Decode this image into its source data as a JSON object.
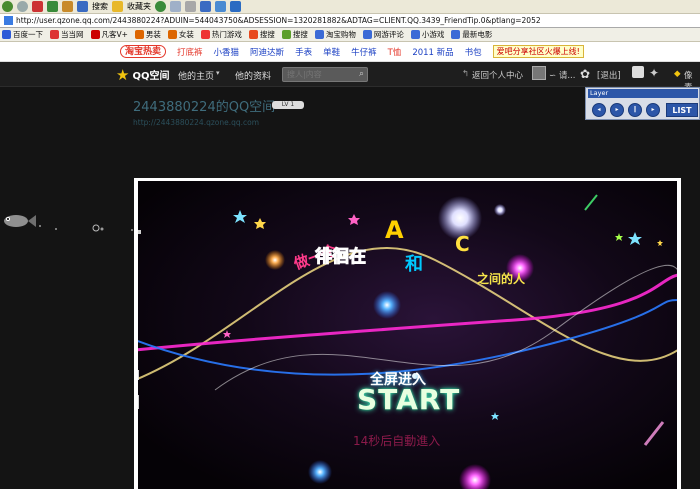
{
  "browser": {
    "toolbar": {
      "search_label": "搜索",
      "favorites_label": "收藏夹"
    },
    "address": "http://user.qzone.qq.com/2443880224?ADUIN=544043750&ADSESSION=1320281882&ADTAG=CLIENT.QQ.3439_FriendTip.0&ptlang=2052",
    "favorites": [
      {
        "label": "百度一下",
        "icon": "baidu-icon",
        "color": "#2e5bd7"
      },
      {
        "label": "当当网",
        "icon": "dangdang-icon",
        "color": "#d33"
      },
      {
        "label": "凡客V+",
        "icon": "vancl-icon",
        "color": "#c00"
      },
      {
        "label": "男装",
        "icon": "mens-icon",
        "color": "#d60"
      },
      {
        "label": "女装",
        "icon": "womens-icon",
        "color": "#d60"
      },
      {
        "label": "热门游戏",
        "icon": "game-icon",
        "color": "#e33"
      },
      {
        "label": "搜搜",
        "icon": "soso-icon",
        "color": "#e8491d"
      },
      {
        "label": "搜搜",
        "icon": "soso2-icon",
        "color": "#5c9e2a"
      },
      {
        "label": "淘宝购物",
        "icon": "taobao-icon",
        "color": "#3b6ad6"
      },
      {
        "label": "网游评论",
        "icon": "review-icon",
        "color": "#3b6ad6"
      },
      {
        "label": "小游戏",
        "icon": "minigame-icon",
        "color": "#3b6ad6"
      },
      {
        "label": "最新电影",
        "icon": "movie-icon",
        "color": "#3b6ad6"
      }
    ]
  },
  "promo": {
    "brand": "淘宝热卖",
    "links": [
      "打底裤",
      "小香猫",
      "阿迪达斯",
      "手表",
      "单鞋",
      "牛仔裤",
      "T恤",
      "2011 新品",
      "书包"
    ],
    "badge": "爱吧分享社区火爆上线!"
  },
  "qzone_nav": {
    "logo": "QQ空间",
    "my_home": "他的主页",
    "his_friends": "他的资料",
    "search_placeholder": "搜人|内容",
    "back_center": "返回个人中心",
    "user_name": "∽ 请...",
    "logout": "[退出]",
    "extra": "像素"
  },
  "player": {
    "title": "Layer",
    "list": "LIST"
  },
  "profile": {
    "title": "2443880224的QQ空间",
    "level": "LV 1",
    "url": "http://2443880224.qzone.qq.com"
  },
  "flash": {
    "slogan_a": "做一个",
    "slogan_b": "徘徊在",
    "slogan_c": "A",
    "slogan_d": "和",
    "slogan_e": "C",
    "slogan_f": "之间的人",
    "enter": "全屏进入",
    "start": "START",
    "countdown": "14秒后自動進入"
  }
}
